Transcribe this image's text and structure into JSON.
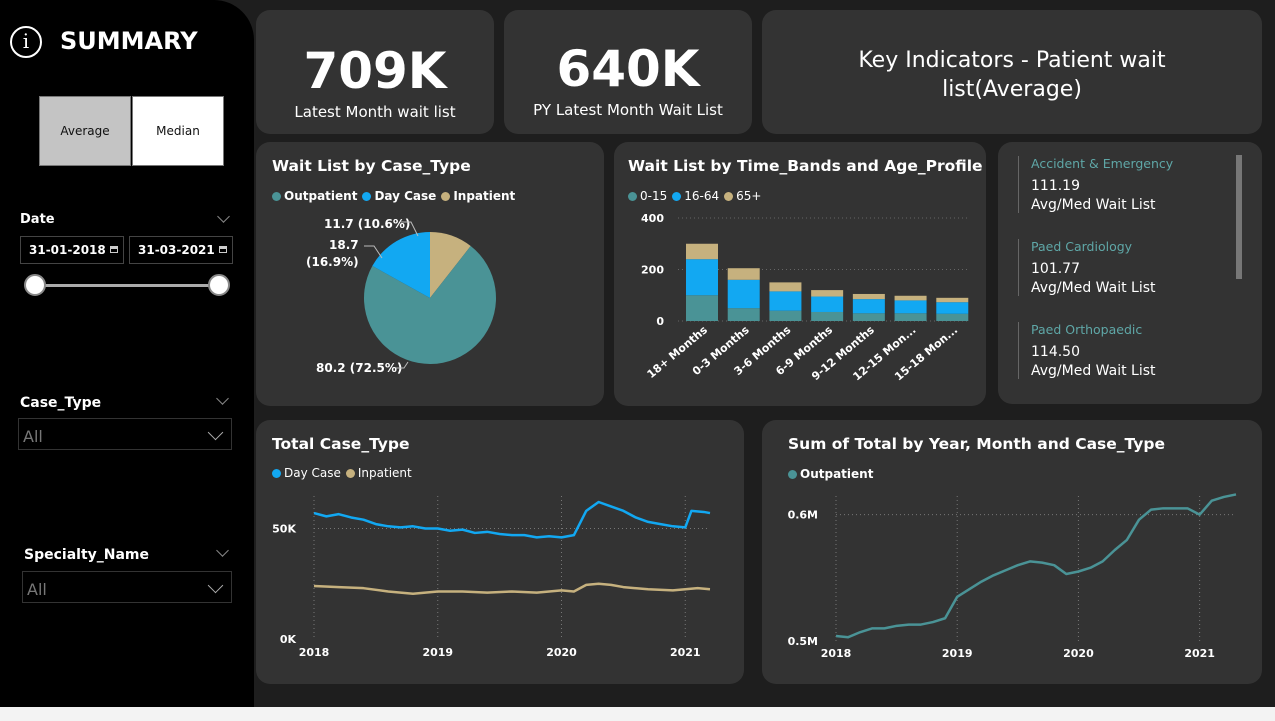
{
  "sidebar": {
    "title": "SUMMARY",
    "toggle": {
      "average": "Average",
      "median": "Median"
    },
    "date": {
      "label": "Date",
      "start": "31-01-2018",
      "end": "31-03-2021"
    },
    "case_type": {
      "label": "Case_Type",
      "value": "All"
    },
    "specialty": {
      "label": "Specialty_Name",
      "value": "All"
    }
  },
  "kpis": [
    {
      "value": "709K",
      "label": "Latest Month wait list"
    },
    {
      "value": "640K",
      "label": "PY Latest Month Wait List"
    }
  ],
  "key_indicators": {
    "title": "Key Indicators - Patient wait list(Average)"
  },
  "indicator_list": [
    {
      "name": "Accident & Emergency",
      "value": "111.19",
      "sub": "Avg/Med Wait List"
    },
    {
      "name": "Paed Cardiology",
      "value": "101.77",
      "sub": "Avg/Med Wait List"
    },
    {
      "name": "Paed Orthopaedic",
      "value": "114.50",
      "sub": "Avg/Med Wait List"
    }
  ],
  "colors": {
    "teal": "#4a9396",
    "blue": "#12a8f2",
    "tan": "#c6b17e"
  },
  "chart_data": [
    {
      "type": "pie",
      "title": "Wait List by Case_Type",
      "legend": [
        "Outpatient",
        "Day Case",
        "Inpatient"
      ],
      "slices": [
        {
          "name": "Outpatient",
          "value": 80.2,
          "label": "80.2 (72.5%)"
        },
        {
          "name": "Day Case",
          "value": 18.7,
          "label_line1": "18.7",
          "label_line2": "(16.9%)"
        },
        {
          "name": "Inpatient",
          "value": 11.7,
          "label": "11.7 (10.6%)"
        }
      ]
    },
    {
      "type": "bar",
      "title": "Wait List by Time_Bands and Age_Profile",
      "legend": [
        "0-15",
        "16-64",
        "65+"
      ],
      "categories": [
        "18+ Months",
        "0-3 Months",
        "3-6 Months",
        "6-9 Months",
        "9-12 Months",
        "12-15 Mon...",
        "15-18 Mon..."
      ],
      "series": [
        {
          "name": "0-15",
          "values": [
            100,
            50,
            40,
            35,
            30,
            30,
            28
          ]
        },
        {
          "name": "16-64",
          "values": [
            140,
            110,
            75,
            60,
            55,
            50,
            45
          ]
        },
        {
          "name": "65+",
          "values": [
            60,
            45,
            35,
            25,
            20,
            18,
            17
          ]
        }
      ],
      "yticks": [
        "0",
        "200",
        "400"
      ],
      "ylim": [
        0,
        400
      ]
    },
    {
      "type": "line",
      "title": "Total Case_Type",
      "legend": [
        "Day Case",
        "Inpatient"
      ],
      "xticks": [
        "2018",
        "2019",
        "2020",
        "2021"
      ],
      "yticks": [
        "0K",
        "50K"
      ],
      "xlim": [
        2018,
        2021.2
      ],
      "ylim": [
        0,
        62000
      ],
      "series": [
        {
          "name": "Day Case",
          "points": [
            [
              2018.0,
              57000
            ],
            [
              2018.1,
              55500
            ],
            [
              2018.2,
              56500
            ],
            [
              2018.3,
              55000
            ],
            [
              2018.4,
              54000
            ],
            [
              2018.5,
              52000
            ],
            [
              2018.6,
              51000
            ],
            [
              2018.7,
              50500
            ],
            [
              2018.8,
              51000
            ],
            [
              2018.9,
              50000
            ],
            [
              2019.0,
              50000
            ],
            [
              2019.1,
              49000
            ],
            [
              2019.2,
              49500
            ],
            [
              2019.3,
              48000
            ],
            [
              2019.4,
              48500
            ],
            [
              2019.5,
              47500
            ],
            [
              2019.6,
              47000
            ],
            [
              2019.7,
              47000
            ],
            [
              2019.8,
              46000
            ],
            [
              2019.9,
              46500
            ],
            [
              2020.0,
              46000
            ],
            [
              2020.1,
              47000
            ],
            [
              2020.2,
              58000
            ],
            [
              2020.3,
              62000
            ],
            [
              2020.4,
              60000
            ],
            [
              2020.5,
              58000
            ],
            [
              2020.6,
              55000
            ],
            [
              2020.7,
              53000
            ],
            [
              2020.8,
              52000
            ],
            [
              2020.9,
              51000
            ],
            [
              2021.0,
              50500
            ],
            [
              2021.05,
              58000
            ],
            [
              2021.15,
              57500
            ],
            [
              2021.2,
              57000
            ]
          ]
        },
        {
          "name": "Inpatient",
          "points": [
            [
              2018.0,
              24000
            ],
            [
              2018.2,
              23500
            ],
            [
              2018.4,
              23000
            ],
            [
              2018.6,
              21500
            ],
            [
              2018.8,
              20500
            ],
            [
              2018.9,
              21000
            ],
            [
              2019.0,
              21500
            ],
            [
              2019.2,
              21500
            ],
            [
              2019.4,
              21000
            ],
            [
              2019.6,
              21500
            ],
            [
              2019.8,
              21000
            ],
            [
              2020.0,
              22000
            ],
            [
              2020.1,
              21500
            ],
            [
              2020.2,
              24500
            ],
            [
              2020.3,
              25000
            ],
            [
              2020.4,
              24500
            ],
            [
              2020.5,
              23500
            ],
            [
              2020.7,
              22500
            ],
            [
              2020.9,
              22000
            ],
            [
              2021.0,
              22500
            ],
            [
              2021.1,
              23000
            ],
            [
              2021.2,
              22500
            ]
          ]
        }
      ]
    },
    {
      "type": "line",
      "title": "Sum of Total by Year, Month and Case_Type",
      "legend": [
        "Outpatient"
      ],
      "xticks": [
        "2018",
        "2019",
        "2020",
        "2021"
      ],
      "yticks": [
        "0.5M",
        "0.6M"
      ],
      "xlim": [
        2018,
        2021.3
      ],
      "ylim": [
        0.5,
        0.61
      ],
      "series": [
        {
          "name": "Outpatient",
          "points": [
            [
              2018.0,
              0.504
            ],
            [
              2018.1,
              0.503
            ],
            [
              2018.2,
              0.507
            ],
            [
              2018.3,
              0.51
            ],
            [
              2018.4,
              0.51
            ],
            [
              2018.5,
              0.512
            ],
            [
              2018.6,
              0.513
            ],
            [
              2018.7,
              0.513
            ],
            [
              2018.8,
              0.515
            ],
            [
              2018.9,
              0.518
            ],
            [
              2019.0,
              0.535
            ],
            [
              2019.1,
              0.541
            ],
            [
              2019.2,
              0.547
            ],
            [
              2019.3,
              0.552
            ],
            [
              2019.4,
              0.556
            ],
            [
              2019.5,
              0.56
            ],
            [
              2019.6,
              0.563
            ],
            [
              2019.7,
              0.562
            ],
            [
              2019.8,
              0.56
            ],
            [
              2019.9,
              0.553
            ],
            [
              2020.0,
              0.555
            ],
            [
              2020.1,
              0.558
            ],
            [
              2020.2,
              0.563
            ],
            [
              2020.3,
              0.572
            ],
            [
              2020.4,
              0.58
            ],
            [
              2020.5,
              0.596
            ],
            [
              2020.6,
              0.604
            ],
            [
              2020.7,
              0.605
            ],
            [
              2020.8,
              0.605
            ],
            [
              2020.9,
              0.605
            ],
            [
              2021.0,
              0.6
            ],
            [
              2021.1,
              0.611
            ],
            [
              2021.2,
              0.614
            ],
            [
              2021.3,
              0.616
            ]
          ]
        }
      ]
    }
  ]
}
